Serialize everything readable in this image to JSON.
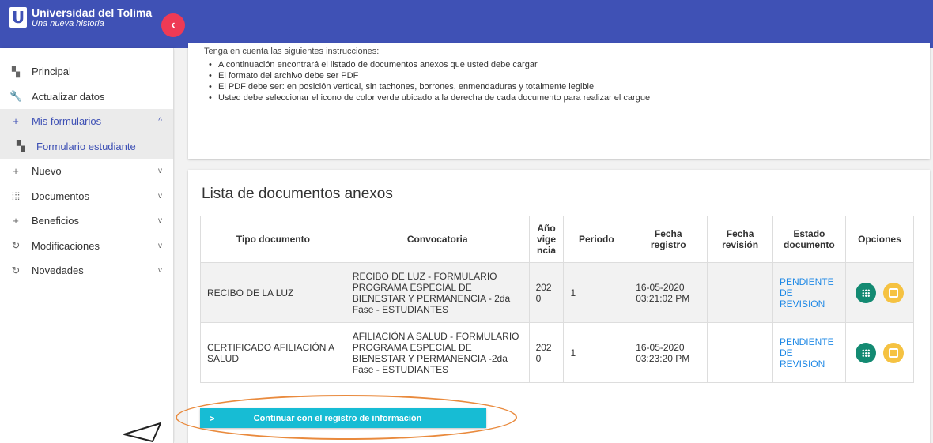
{
  "header": {
    "title": "Universidad del Tolima",
    "subtitle": "Una nueva historia",
    "logo_letter": "U",
    "toggle_glyph": "‹",
    "bar_color": "#3f51b5",
    "toggle_color": "#ee3a55"
  },
  "sidebar": {
    "items": [
      {
        "label": "Principal",
        "icon": "dashboard-icon",
        "glyph": "▚"
      },
      {
        "label": "Actualizar datos",
        "icon": "wrench-icon",
        "glyph": "🔧"
      },
      {
        "label": "Mis formularios",
        "icon": "plus-icon",
        "glyph": "+",
        "chev": "^"
      },
      {
        "label": "Formulario estudiante",
        "icon": "dashboard-icon",
        "glyph": "▚"
      },
      {
        "label": "Nuevo",
        "icon": "plus-icon",
        "glyph": "+",
        "chev": "v"
      },
      {
        "label": "Documentos",
        "icon": "apps-grid-icon",
        "glyph": "⁞⁞⁞",
        "chev": "v"
      },
      {
        "label": "Beneficios",
        "icon": "plus-icon",
        "glyph": "+",
        "chev": "v"
      },
      {
        "label": "Modificaciones",
        "icon": "history-icon",
        "glyph": "↻",
        "chev": "v"
      },
      {
        "label": "Novedades",
        "icon": "history-icon",
        "glyph": "↻",
        "chev": "v"
      }
    ]
  },
  "instructions": {
    "title": "Tenga en cuenta las siguientes instrucciones:",
    "items": [
      "A continuación encontrará el listado de documentos anexos que usted debe cargar",
      "El formato del archivo debe ser PDF",
      "El PDF debe ser: en posición vertical, sin tachones, borrones, enmendaduras y totalmente legible",
      "Usted debe seleccionar el icono de color verde ubicado a la derecha de cada documento para realizar el cargue"
    ]
  },
  "documents": {
    "title": "Lista de documentos anexos",
    "columns": [
      "Tipo documento",
      "Convocatoria",
      "Año vige ncia",
      "Periodo",
      "Fecha registro",
      "Fecha revisión",
      "Estado documento",
      "Opciones"
    ],
    "rows": [
      {
        "tipo": "RECIBO DE LA LUZ",
        "convocatoria": "RECIBO DE LUZ - FORMULARIO PROGRAMA ESPECIAL DE BIENESTAR Y PERMANENCIA - 2da Fase - ESTUDIANTES",
        "anio": "202 0",
        "periodo": "1",
        "fecha_registro": "16-05-2020 03:21:02 PM",
        "fecha_revision": "",
        "estado": "PENDIENTE DE REVISION"
      },
      {
        "tipo": "CERTIFICADO AFILIACIÓN A SALUD",
        "convocatoria": "AFILIACIÓN A SALUD - FORMULARIO PROGRAMA ESPECIAL DE BIENESTAR Y PERMANENCIA -2da Fase - ESTUDIANTES",
        "anio": "202 0",
        "periodo": "1",
        "fecha_registro": "16-05-2020 03:23:20 PM",
        "fecha_revision": "",
        "estado": "PENDIENTE DE REVISION"
      }
    ],
    "option_icons": [
      "upload-grid-icon",
      "image-icon"
    ],
    "colors": {
      "green": "#138a72",
      "yellow": "#f5c242",
      "estado": "#1e88e5"
    }
  },
  "actions": {
    "continue_arrow": ">",
    "continue_label": "Continuar con el registro de información",
    "continue_color": "#17bcd4"
  },
  "annotation": {
    "highlight_color": "#e98a3d"
  }
}
